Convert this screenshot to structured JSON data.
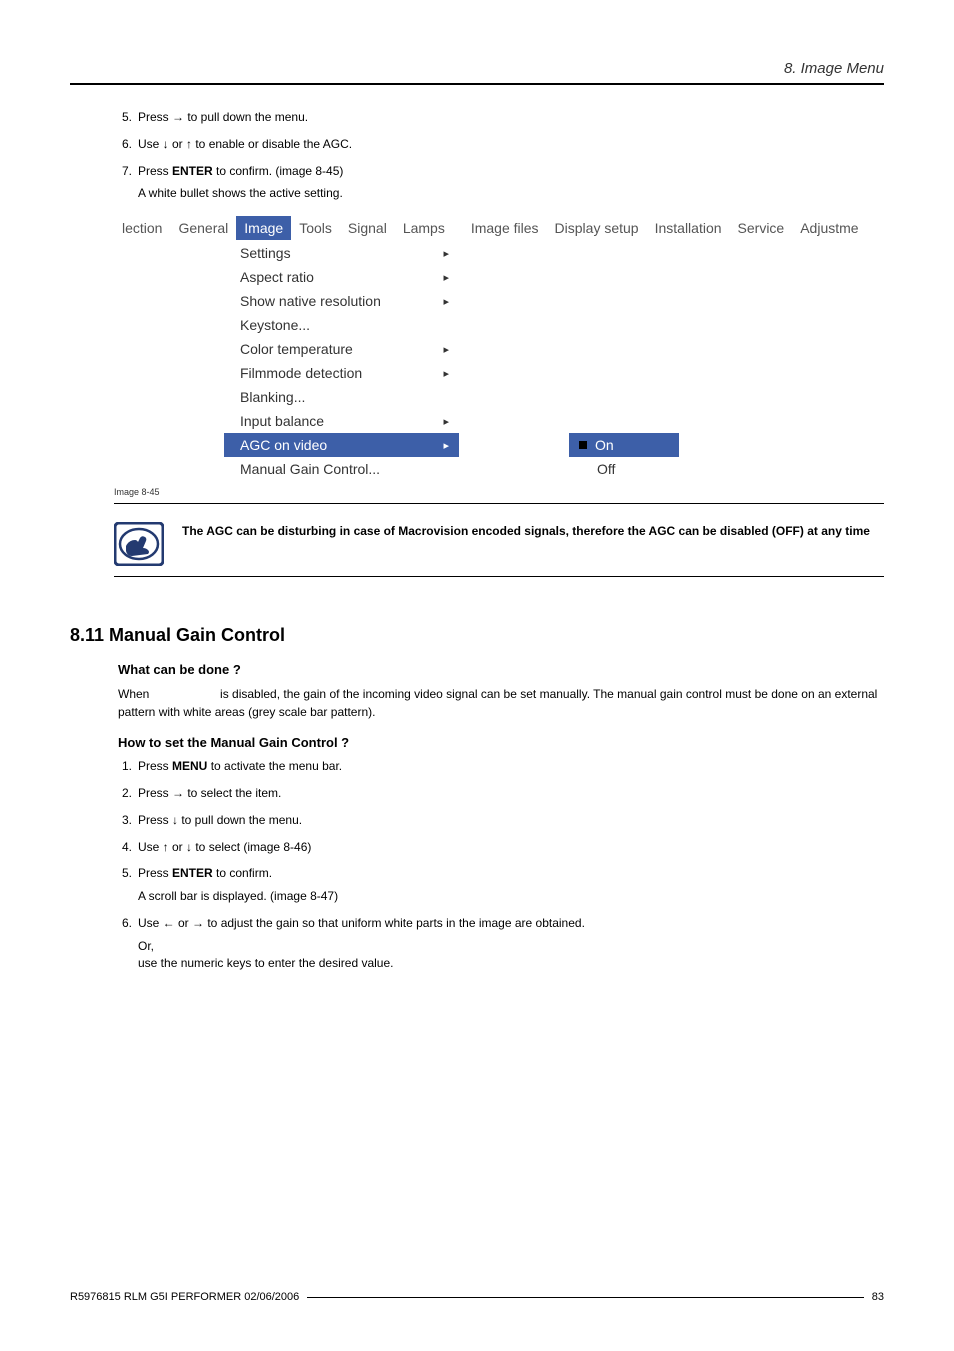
{
  "header": {
    "section": "8. Image Menu"
  },
  "steps_a": [
    {
      "n": "5.",
      "text": "Press → to pull down the menu."
    },
    {
      "n": "6.",
      "text": "Use ↓ or ↑ to enable or disable the AGC."
    },
    {
      "n": "7.",
      "text": "Press ENTER to confirm. (image 8-45)",
      "sub": "A white bullet shows the active setting."
    }
  ],
  "menubar": {
    "tabs": [
      "lection",
      "General",
      "Image",
      "Tools",
      "Signal",
      "Lamps",
      "Image files",
      "Display setup",
      "Installation",
      "Service",
      "Adjustme"
    ],
    "active_index": 2
  },
  "dropdown": {
    "items": [
      {
        "label": "Settings",
        "arrow": true
      },
      {
        "label": "Aspect ratio",
        "arrow": true
      },
      {
        "label": "Show native resolution",
        "arrow": true
      },
      {
        "label": "Keystone...",
        "arrow": false
      },
      {
        "label": "Color temperature",
        "arrow": true
      },
      {
        "label": "Filmmode detection",
        "arrow": true
      },
      {
        "label": "Blanking...",
        "arrow": false
      },
      {
        "label": "Input balance",
        "arrow": true
      },
      {
        "label": "AGC on video",
        "arrow": true,
        "active": true
      },
      {
        "label": "Manual Gain Control...",
        "arrow": false
      }
    ]
  },
  "submenu": {
    "items": [
      {
        "label": "On",
        "active": true,
        "bullet": true
      },
      {
        "label": "Off",
        "active": false,
        "bullet": false
      }
    ]
  },
  "caption_a": "Image 8-45",
  "note": "The AGC can be disturbing in case of Macrovision encoded signals, therefore the AGC can be disabled (OFF) at any time",
  "section_b": {
    "heading": "8.11  Manual Gain Control",
    "what_h": "What can be done ?",
    "what_prefix": "When ",
    "what_body": " is disabled, the gain of the incoming video signal can be set manually. The manual gain control must be done on an external pattern with white areas (grey scale bar pattern).",
    "how_h": "How to set the Manual Gain Control ?"
  },
  "steps_b": [
    {
      "n": "1.",
      "text": "Press MENU to activate the menu bar."
    },
    {
      "n": "2.",
      "text": "Press → to select the          item."
    },
    {
      "n": "3.",
      "text": "Press ↓ to pull down the          menu."
    },
    {
      "n": "4.",
      "text": "Use ↑ or ↓ to select                                   (image 8-46)"
    },
    {
      "n": "5.",
      "text": "Press ENTER to confirm.",
      "sub": "A scroll bar is displayed. (image 8-47)"
    },
    {
      "n": "6.",
      "text": "Use ← or → to adjust the gain so that uniform white parts in the image are obtained.",
      "sub": "Or,",
      "sub2": "use the numeric keys to enter the desired value."
    }
  ],
  "footer": {
    "left": "R5976815  RLM G5I PERFORMER  02/06/2006",
    "page": "83"
  }
}
